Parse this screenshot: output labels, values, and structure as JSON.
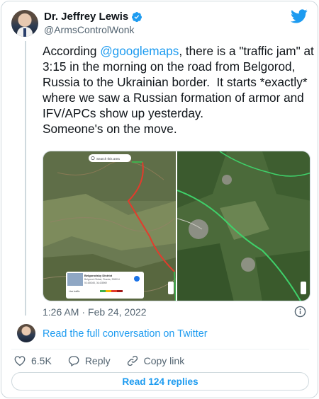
{
  "author": {
    "display_name": "Dr. Jeffrey Lewis",
    "handle": "@ArmsControlWonk",
    "verified": true
  },
  "tweet": {
    "text_before_mention": "According ",
    "mention": "@googlemaps",
    "text_after_mention": ", there is a \"traffic jam\" at 3:15 in the morning on the road from Belgorod, Russia to the Ukrainian border.  It starts *exactly* where we saw a Russian formation of armor and IFV/APCs show up yesterday.\nSomeone's on the move.",
    "time": "1:26 AM",
    "date_separator": "·",
    "date": "Feb 24, 2022"
  },
  "media": {
    "left_map": {
      "search_placeholder": "Search this area",
      "place_title": "Belgorodsky District",
      "place_subtitle": "Belgorod Oblast, Russia, 308014",
      "place_coords": "50.486045, 36.438969",
      "traffic_label": "Live traffic"
    }
  },
  "conversation_link": "Read the full conversation on Twitter",
  "actions": {
    "likes": "6.5K",
    "reply_label": "Reply",
    "copy_link_label": "Copy link"
  },
  "read_replies": "Read 124 replies",
  "colors": {
    "link_blue": "#1d9bf0",
    "text_primary": "#0f1419",
    "text_secondary": "#536471",
    "border": "#cfd9de"
  },
  "icons": [
    "verified-badge-icon",
    "twitter-bird-icon",
    "info-icon",
    "heart-icon",
    "reply-bubble-icon",
    "link-icon"
  ]
}
